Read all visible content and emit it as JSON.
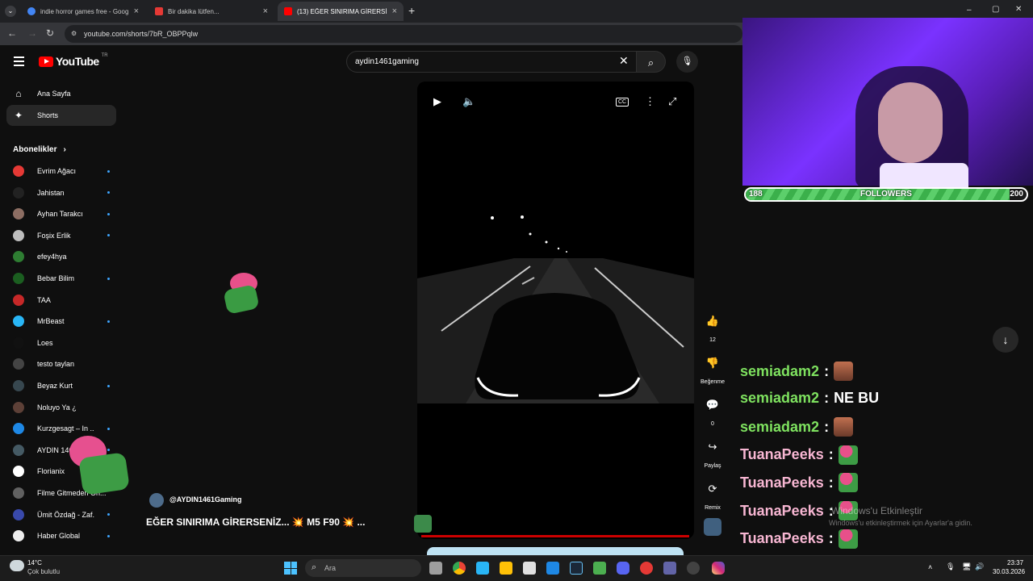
{
  "browser": {
    "tabs": [
      {
        "title": "indie horror games free - Goog",
        "favicon_color": "#4285f4"
      },
      {
        "title": "Bir dakika lütfen...",
        "favicon_color": "#e53935"
      },
      {
        "title": "(13) EĞER SINIRIMA GİRERSİ",
        "favicon_color": "#ff0000"
      }
    ],
    "new_tab": "+",
    "url": "youtube.com/shorts/7bR_OBPPqlw",
    "window_controls": {
      "minimize": "–",
      "maximize": "▢",
      "close": "✕"
    }
  },
  "youtube": {
    "logo_text": "YouTube",
    "region": "TR",
    "search_value": "aydin1461gaming",
    "nav": [
      {
        "label": "Ana Sayfa",
        "icon": "home-icon"
      },
      {
        "label": "Shorts",
        "icon": "shorts-icon"
      }
    ],
    "subscriptions_header": "Abonelikler",
    "subscriptions": [
      {
        "name": "Evrim Ağacı",
        "color": "#e53935",
        "live": true
      },
      {
        "name": "Jahistan",
        "color": "#222222",
        "live": true
      },
      {
        "name": "Ayhan Tarakcı",
        "color": "#8d6e63",
        "live": true
      },
      {
        "name": "Foşix Erlik",
        "color": "#bdbdbd",
        "live": true
      },
      {
        "name": "efey4hya",
        "color": "#2e7d32",
        "live": false
      },
      {
        "name": "Bebar Bilim",
        "color": "#1b5e20",
        "live": true
      },
      {
        "name": "TAA",
        "color": "#c62828",
        "live": false
      },
      {
        "name": "MrBeast",
        "color": "#29b6f6",
        "live": true
      },
      {
        "name": "Loes",
        "color": "#111111",
        "live": false
      },
      {
        "name": "testo taylan",
        "color": "#444444",
        "live": false
      },
      {
        "name": "Beyaz Kurt",
        "color": "#37474f",
        "live": true
      },
      {
        "name": "Noluyo Ya ¿",
        "color": "#5d4037",
        "live": false
      },
      {
        "name": "Kurzgesagt – In ...",
        "color": "#1e88e5",
        "live": true
      },
      {
        "name": "AYDIN 1461 Gaming",
        "color": "#455a64",
        "live": true
      },
      {
        "name": "Florianix",
        "color": "#ffffff",
        "live": false
      },
      {
        "name": "Filme Gitmeden On...",
        "color": "#616161",
        "live": false
      },
      {
        "name": "Ümit Özdağ - Zaf...",
        "color": "#3949ab",
        "live": true
      },
      {
        "name": "Haber Global",
        "color": "#eeeeee",
        "live": true
      }
    ],
    "short": {
      "channel": "@AYDIN1461Gaming",
      "title": "EĞER SINIRIMA GİRERSENİZ... 💥 M5 F90 💥 ...",
      "progress": 1.0
    },
    "actions": [
      {
        "name": "like",
        "icon": "thumbs-up-icon",
        "glyph": "👍",
        "label": "12"
      },
      {
        "name": "dislike",
        "icon": "thumbs-down-icon",
        "glyph": "👎",
        "label": "Beğenme"
      },
      {
        "name": "comments",
        "icon": "comment-icon",
        "glyph": "💬",
        "label": "0"
      },
      {
        "name": "share",
        "icon": "share-icon",
        "glyph": "↪",
        "label": "Paylaş"
      },
      {
        "name": "remix",
        "icon": "remix-icon",
        "glyph": "⟳",
        "label": "Remix"
      }
    ]
  },
  "stream": {
    "followers": {
      "label": "FOLLOWERS",
      "current": "188",
      "goal": "200",
      "fraction": 0.94
    },
    "chat": [
      {
        "user": "semiadam2",
        "message": "",
        "user_color": "#7ee15f",
        "emote": "face-emote"
      },
      {
        "user": "semiadam2",
        "message": "NE BU",
        "user_color": "#7ee15f",
        "emote": ""
      },
      {
        "user": "semiadam2",
        "message": "",
        "user_color": "#7ee15f",
        "emote": "face-emote"
      },
      {
        "user": "TuanaPeeks",
        "message": "",
        "user_color": "#f7b6d2",
        "emote": "frog-emote"
      },
      {
        "user": "TuanaPeeks",
        "message": "",
        "user_color": "#f7b6d2",
        "emote": "frog-emote"
      },
      {
        "user": "TuanaPeeks",
        "message": "",
        "user_color": "#f7b6d2",
        "emote": "frog-emote"
      },
      {
        "user": "TuanaPeeks",
        "message": "",
        "user_color": "#f7b6d2",
        "emote": "frog-emote"
      },
      {
        "user": "TuanaPeeks",
        "message": "",
        "user_color": "#f7b6d2",
        "emote": "frog-emote"
      }
    ],
    "activation_title": "Windows'u Etkinleştir",
    "activation_sub": "Windows'u etkinleştirmek için Ayarlar'a gidin."
  },
  "taskbar": {
    "weather_temp": "14°C",
    "weather_desc": "Çok bulutlu",
    "search_placeholder": "Ara",
    "time": "23:37",
    "date": "30.03.2026"
  }
}
